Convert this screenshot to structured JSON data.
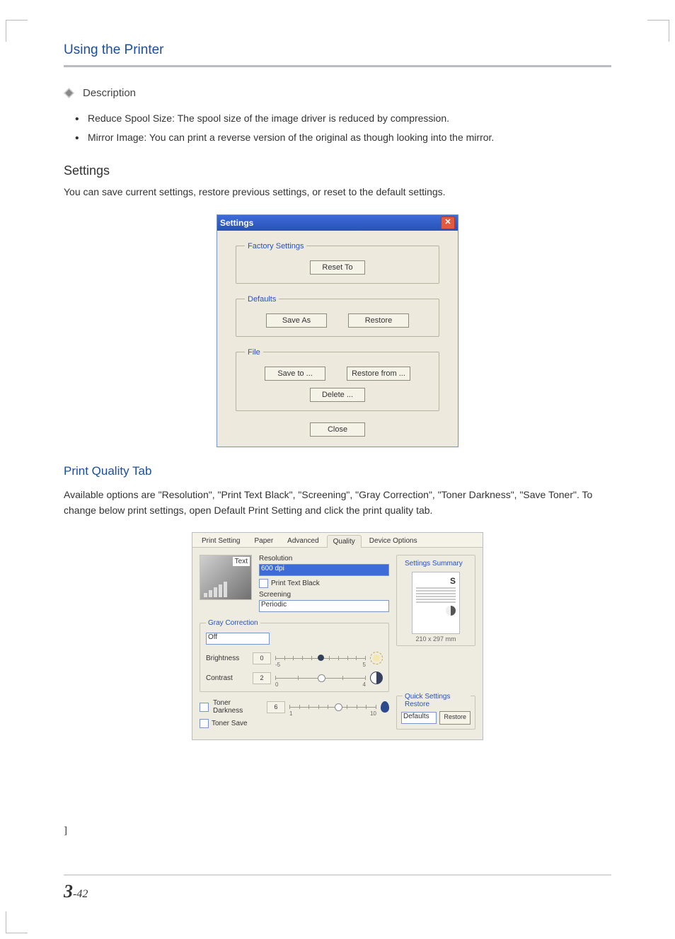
{
  "header": {
    "breadcrumb": "Using the Printer"
  },
  "description": {
    "heading": "Description",
    "items": [
      "Reduce Spool Size: The spool size of the image driver is reduced by compression.",
      "Mirror Image: You can print a reverse version of the original as though looking into the mirror."
    ]
  },
  "settings_section": {
    "heading": "Settings",
    "body": "You can save current settings, restore previous settings, or reset to the default settings."
  },
  "settings_dialog": {
    "title": "Settings",
    "close_glyph": "✕",
    "factory": {
      "legend": "Factory Settings",
      "reset_to": "Reset To"
    },
    "defaults": {
      "legend": "Defaults",
      "save_as": "Save As",
      "restore": "Restore"
    },
    "file": {
      "legend": "File",
      "save_to": "Save to ...",
      "restore_from": "Restore from ...",
      "delete": "Delete ..."
    },
    "close": "Close"
  },
  "pq_section": {
    "heading": "Print Quality Tab",
    "body": "Available options are \"Resolution\", \"Print Text Black\", \"Screening\", \"Gray Correction\", \"Toner Darkness\", \"Save Toner\". To change below print settings, open Default Print Setting and click the print quality tab."
  },
  "pq_dialog": {
    "tabs": {
      "print_setting": "Print Setting",
      "paper": "Paper",
      "advanced": "Advanced",
      "quality": "Quality",
      "device_options": "Device Options"
    },
    "thumb_label": "Text",
    "resolution": {
      "label": "Resolution",
      "value": "600 dpi"
    },
    "print_text_black": "Print Text Black",
    "screening": {
      "label": "Screening",
      "value": "Periodic"
    },
    "gray": {
      "legend": "Gray Correction",
      "mode": "Off",
      "brightness": {
        "label": "Brightness",
        "value": "0",
        "min": "-5",
        "max": "5"
      },
      "contrast": {
        "label": "Contrast",
        "value": "2",
        "min": "0",
        "max": "4"
      }
    },
    "toner_darkness": {
      "label": "Toner Darkness",
      "value": "6",
      "min": "1",
      "max": "10"
    },
    "toner_save": "Toner Save",
    "summary": {
      "legend": "Settings Summary",
      "dim": "210 x 297 mm",
      "s": "S"
    },
    "qsr": {
      "legend": "Quick Settings Restore",
      "value": "Defaults",
      "restore": "Restore"
    }
  },
  "stray": "]",
  "footer": {
    "chapter": "3",
    "page": "-42"
  }
}
